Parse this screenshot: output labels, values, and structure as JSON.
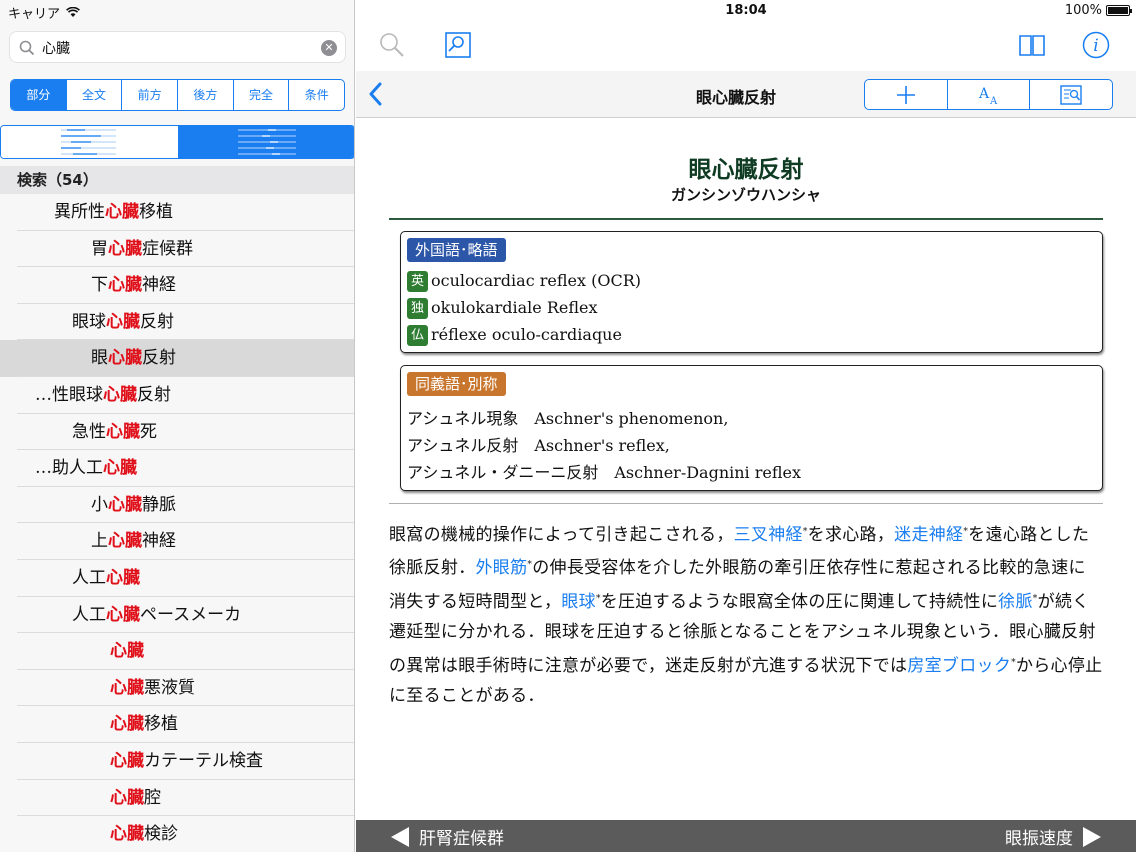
{
  "status": {
    "carrier": "キャリア",
    "time": "18:04",
    "battery": "100%"
  },
  "search": {
    "value": "心臓",
    "placeholder": "検索"
  },
  "modes": [
    "部分",
    "全文",
    "前方",
    "後方",
    "完全",
    "条件"
  ],
  "results_header": "検索（54）",
  "results": [
    {
      "pre": "異所性",
      "hl": "心臓",
      "post": "移植",
      "indent": 54
    },
    {
      "pre": "胃",
      "hl": "心臓",
      "post": "症候群",
      "indent": 91
    },
    {
      "pre": "下",
      "hl": "心臓",
      "post": "神経",
      "indent": 91
    },
    {
      "pre": "眼球",
      "hl": "心臓",
      "post": "反射",
      "indent": 72
    },
    {
      "pre": "眼",
      "hl": "心臓",
      "post": "反射",
      "indent": 91,
      "selected": true
    },
    {
      "pre": "…性眼球",
      "hl": "心臓",
      "post": "反射",
      "indent": 35
    },
    {
      "pre": "急性",
      "hl": "心臓",
      "post": "死",
      "indent": 72
    },
    {
      "pre": "…助人工",
      "hl": "心臓",
      "post": "",
      "indent": 35
    },
    {
      "pre": "小",
      "hl": "心臓",
      "post": "静脈",
      "indent": 91
    },
    {
      "pre": "上",
      "hl": "心臓",
      "post": "神経",
      "indent": 91
    },
    {
      "pre": "人工",
      "hl": "心臓",
      "post": "",
      "indent": 72
    },
    {
      "pre": "人工",
      "hl": "心臓",
      "post": "ペースメーカ",
      "indent": 72
    },
    {
      "pre": "",
      "hl": "心臓",
      "post": "",
      "indent": 110
    },
    {
      "pre": "",
      "hl": "心臓",
      "post": "悪液質",
      "indent": 110
    },
    {
      "pre": "",
      "hl": "心臓",
      "post": "移植",
      "indent": 110
    },
    {
      "pre": "",
      "hl": "心臓",
      "post": "カテーテル検査",
      "indent": 110
    },
    {
      "pre": "",
      "hl": "心臓",
      "post": "腔",
      "indent": 110
    },
    {
      "pre": "",
      "hl": "心臓",
      "post": "検診",
      "indent": 110
    }
  ],
  "nav": {
    "title": "眼心臓反射"
  },
  "entry": {
    "title": "眼心臓反射",
    "kana": "ガンシンゾウハンシャ",
    "foreign_tag": "外国語･略語",
    "foreign": [
      {
        "badge": "英",
        "text": "oculocardiac reflex (OCR)"
      },
      {
        "badge": "独",
        "text": "okulokardiale Reflex"
      },
      {
        "badge": "仏",
        "text": "réflexe oculo-cardiaque"
      }
    ],
    "synonym_tag": "同義語･別称",
    "synonyms": [
      "アシュネル現象　Aschner's phenomenon,",
      "アシュネル反射　Aschner's reflex,",
      "アシュネル・ダニーニ反射　Aschner-Dagnini reflex"
    ],
    "body": {
      "t1": "眼窩の機械的操作によって引き起こされる，",
      "l1": "三叉神経",
      "t2": "を求心路，",
      "l2": "迷走神経",
      "t3": "を遠心路とした徐脈反射．",
      "l3": "外眼筋",
      "t4": "の伸長受容体を介した外眼筋の牽引圧依存性に惹起される比較的急速に消失する短時間型と，",
      "l4": "眼球",
      "t5": "を圧迫するような眼窩全体の圧に関連して持続性に",
      "l5": "徐脈",
      "t6": "が続く遷延型に分かれる．眼球を圧迫すると徐脈となることをアシュネル現象という．眼心臓反射の異常は眼手術時に注意が必要で，迷走反射が亢進する状況下では",
      "l6": "房室ブロック",
      "t7": "から心停止に至ることがある．",
      "mark": "*"
    }
  },
  "footer": {
    "prev": "肝腎症候群",
    "next": "眼振速度"
  },
  "colors": {
    "accent": "#1a7ef0",
    "highlight": "#e0101a",
    "heading": "#0e3b22"
  }
}
